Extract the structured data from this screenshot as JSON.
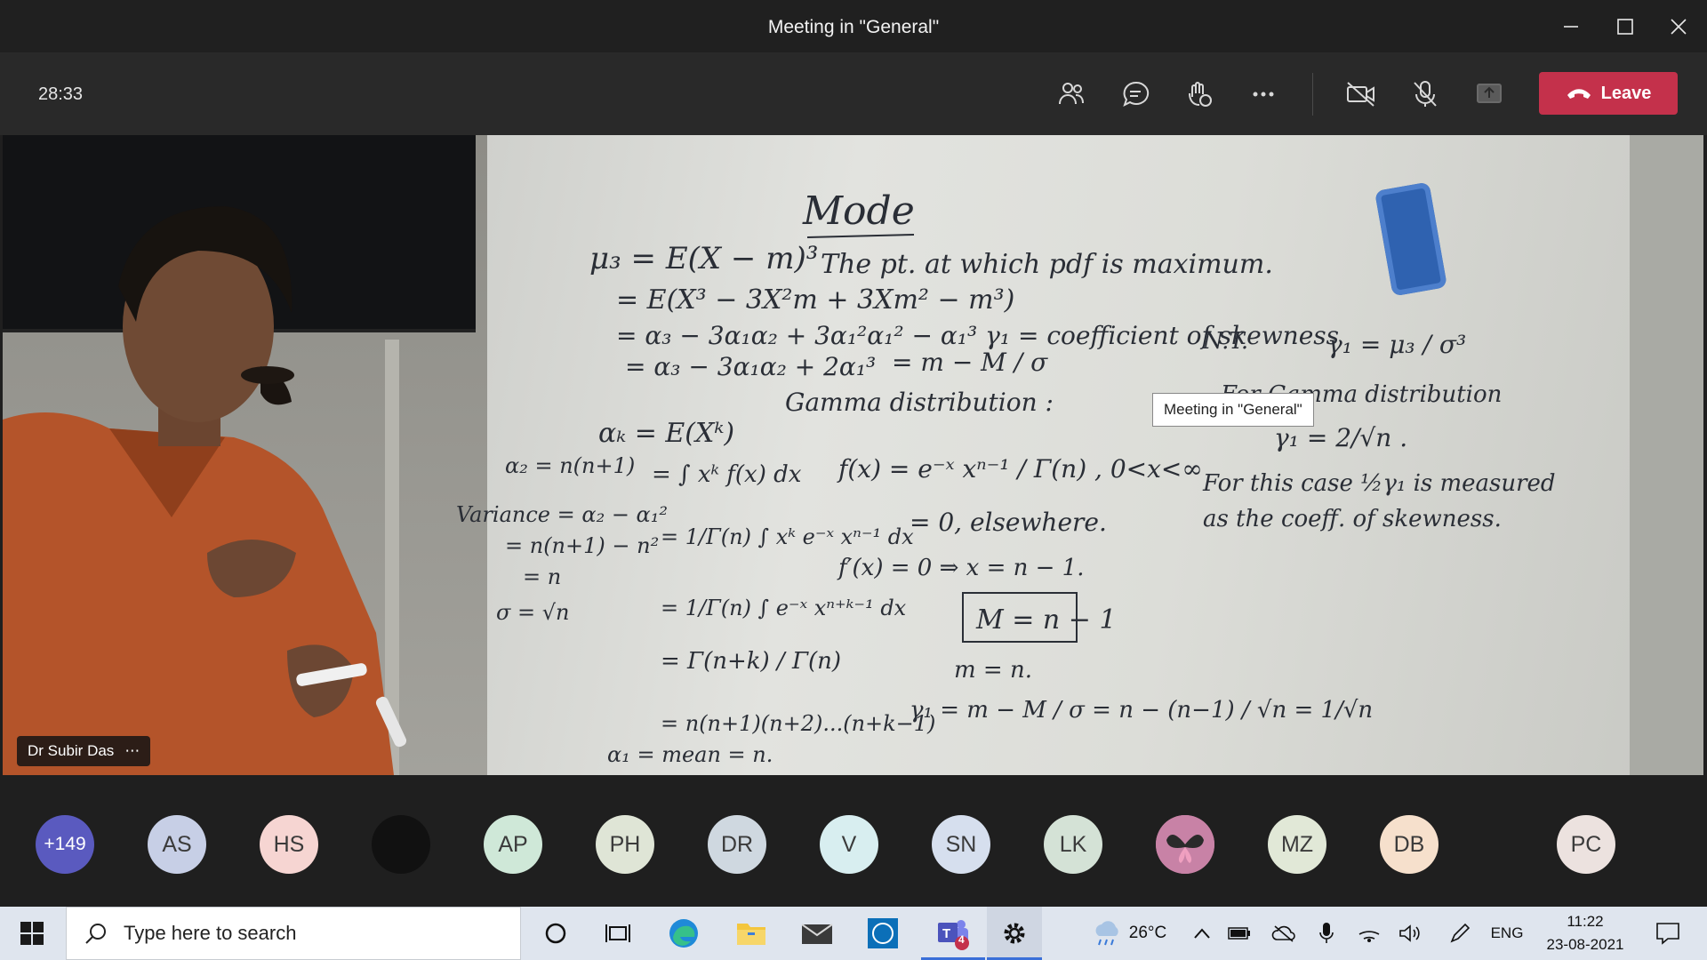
{
  "window": {
    "title": "Meeting in \"General\""
  },
  "toolbar": {
    "timer": "28:33",
    "leave_label": "Leave",
    "icons": [
      "people-icon",
      "chat-icon",
      "reactions-icon",
      "more-icon",
      "camera-off-icon",
      "mic-off-icon",
      "share-icon",
      "phone-icon"
    ]
  },
  "video": {
    "presenter_name": "Dr Subir Das",
    "presenter_more": "⋯",
    "tooltip": "Meeting in \"General\""
  },
  "participants": {
    "overflow": "+149",
    "avatars": [
      {
        "initials": "AS",
        "color": "#c7cfe6"
      },
      {
        "initials": "HS",
        "color": "#f6d5d2"
      },
      {
        "initials": "",
        "color": "#111111"
      },
      {
        "initials": "AP",
        "color": "#cfe8d8"
      },
      {
        "initials": "PH",
        "color": "#dfe5d6"
      },
      {
        "initials": "DR",
        "color": "#cfd8e0"
      },
      {
        "initials": "V",
        "color": "#d8eef0"
      },
      {
        "initials": "SN",
        "color": "#d6dfee"
      },
      {
        "initials": "LK",
        "color": "#d4e2d6"
      },
      {
        "initials": "",
        "color": "#c882a6"
      },
      {
        "initials": "MZ",
        "color": "#e1e8d7"
      },
      {
        "initials": "DB",
        "color": "#f6e0cc"
      },
      {
        "initials": "PC",
        "color": "#ece2df"
      }
    ]
  },
  "taskbar": {
    "search_placeholder": "Type here to search",
    "temperature": "26°C",
    "language": "ENG",
    "time": "11:22",
    "date": "23-08-2021",
    "teams_badge": "4",
    "accent": "#3a6fd8"
  }
}
